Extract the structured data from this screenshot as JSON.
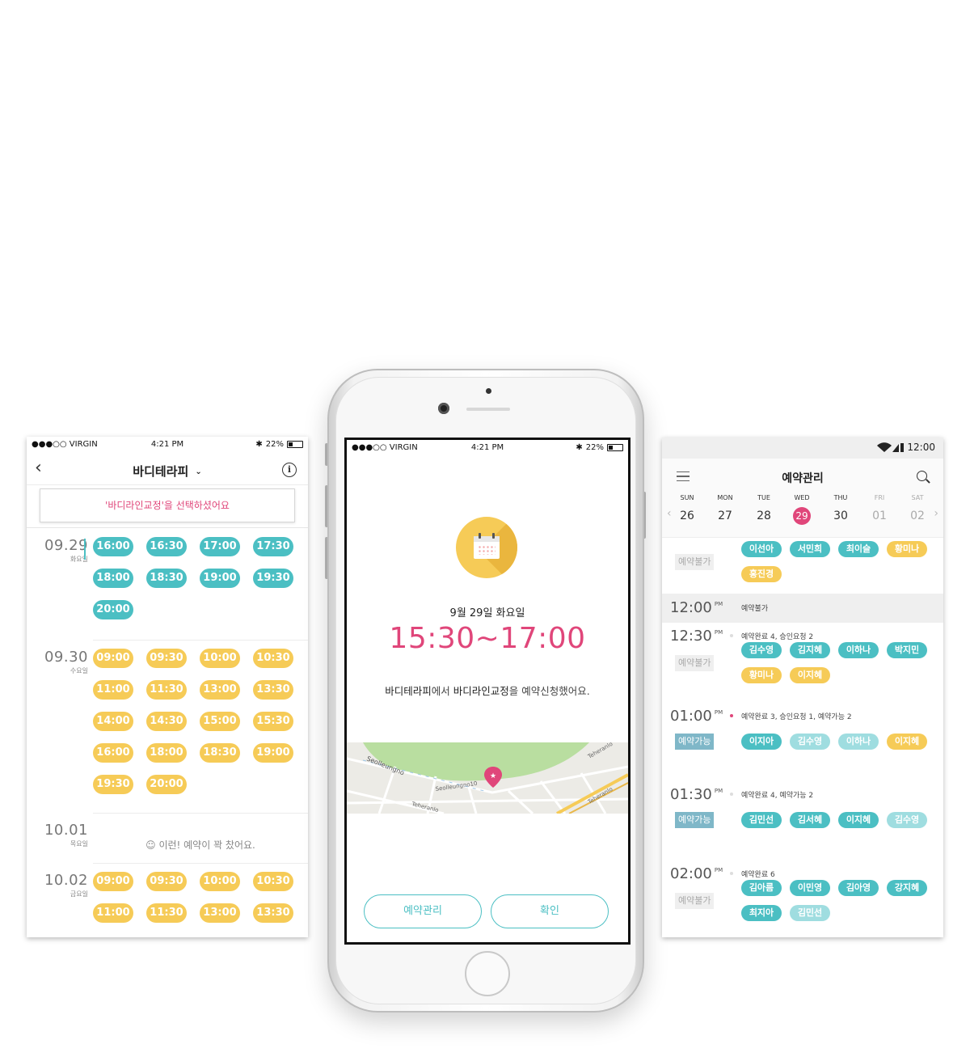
{
  "left": {
    "status": {
      "carrier": "●●●○○ VIRGIN",
      "time": "4:21 PM",
      "battery": "22%"
    },
    "title": "바디테라피",
    "notice": "'바디라인교정'을 선택하셨어요",
    "days": [
      {
        "date": "09.29",
        "dow": "화요일",
        "slots": [
          "16:00",
          "16:30",
          "17:00",
          "17:30",
          "18:00",
          "18:30",
          "19:00",
          "19:30",
          "20:00"
        ],
        "color": "teal"
      },
      {
        "date": "09.30",
        "dow": "수요일",
        "slots": [
          "09:00",
          "09:30",
          "10:00",
          "10:30",
          "11:00",
          "11:30",
          "13:00",
          "13:30",
          "14:00",
          "14:30",
          "15:00",
          "15:30",
          "16:00",
          "18:00",
          "18:30",
          "19:00",
          "19:30",
          "20:00"
        ],
        "color": "yellow"
      },
      {
        "date": "10.01",
        "dow": "목요일",
        "empty": "이런! 예약이 꽉 찼어요."
      },
      {
        "date": "10.02",
        "dow": "금요일",
        "slots": [
          "09:00",
          "09:30",
          "10:00",
          "10:30",
          "11:00",
          "11:30",
          "13:00",
          "13:30"
        ],
        "color": "yellow"
      }
    ]
  },
  "center": {
    "status": {
      "carrier": "●●●○○ VIRGIN",
      "time": "4:21 PM",
      "battery": "22%"
    },
    "date": "9월 29일 화요일",
    "time": "15:30~17:00",
    "message": {
      "place": "바디테라피",
      "part1": "에서 ",
      "service": "바디라인교정",
      "part2": "을 예약신청했어요."
    },
    "map_labels": [
      "Seolleungno",
      "Seolleungno10",
      "Teheranlo",
      "Teheranlo",
      "Teheranlo"
    ],
    "buttons": {
      "manage": "예약관리",
      "confirm": "확인"
    }
  },
  "right": {
    "status": {
      "time": "12:00"
    },
    "title": "예약관리",
    "week": [
      {
        "n": "SUN",
        "d": "26"
      },
      {
        "n": "MON",
        "d": "27"
      },
      {
        "n": "TUE",
        "d": "28"
      },
      {
        "n": "WED",
        "d": "29",
        "selected": true
      },
      {
        "n": "THU",
        "d": "30"
      },
      {
        "n": "FRI",
        "d": "01",
        "faded": true
      },
      {
        "n": "SAT",
        "d": "02",
        "faded": true
      }
    ],
    "top": {
      "badge": "예약불가",
      "chips": [
        {
          "name": "이선아",
          "c": "teal"
        },
        {
          "name": "서민희",
          "c": "teal"
        },
        {
          "name": "최이슬",
          "c": "teal"
        },
        {
          "name": "황미나",
          "c": "yellow"
        },
        {
          "name": "홍진경",
          "c": "yellow"
        }
      ]
    },
    "slots": [
      {
        "time": "12:00",
        "ampm": "PM",
        "info": "예약불가",
        "highlight": true
      },
      {
        "time": "12:30",
        "ampm": "PM",
        "info": "예약완료 4, 승인요청 2",
        "badge": "예약불가",
        "badge_type": "gray",
        "chips": [
          {
            "name": "김수영",
            "c": "teal"
          },
          {
            "name": "김지혜",
            "c": "teal"
          },
          {
            "name": "이하나",
            "c": "teal"
          },
          {
            "name": "박지민",
            "c": "teal"
          },
          {
            "name": "황미나",
            "c": "yellow"
          },
          {
            "name": "이지혜",
            "c": "yellow"
          }
        ]
      },
      {
        "time": "01:00",
        "ampm": "PM",
        "info": "예약완료 3, 승인요청 1, 예약가능 2",
        "red": true,
        "badge": "예약가능",
        "badge_type": "blue",
        "chips": [
          {
            "name": "이지아",
            "c": "teal"
          },
          {
            "name": "김수영",
            "c": "lt"
          },
          {
            "name": "이하나",
            "c": "lt"
          },
          {
            "name": "이지혜",
            "c": "yellow"
          }
        ]
      },
      {
        "time": "01:30",
        "ampm": "PM",
        "info": "예약완료 4, 예약가능 2",
        "badge": "예약가능",
        "badge_type": "blue",
        "chips": [
          {
            "name": "김민선",
            "c": "teal"
          },
          {
            "name": "김서혜",
            "c": "teal"
          },
          {
            "name": "이지혜",
            "c": "teal"
          },
          {
            "name": "김수영",
            "c": "lt"
          }
        ]
      },
      {
        "time": "02:00",
        "ampm": "PM",
        "info": "예약완료 6",
        "badge": "예약불가",
        "badge_type": "gray",
        "chips": [
          {
            "name": "김아름",
            "c": "teal"
          },
          {
            "name": "이민영",
            "c": "teal"
          },
          {
            "name": "김아영",
            "c": "teal"
          },
          {
            "name": "강지혜",
            "c": "teal"
          },
          {
            "name": "최지아",
            "c": "teal"
          },
          {
            "name": "김민선",
            "c": "lt"
          }
        ]
      }
    ]
  }
}
